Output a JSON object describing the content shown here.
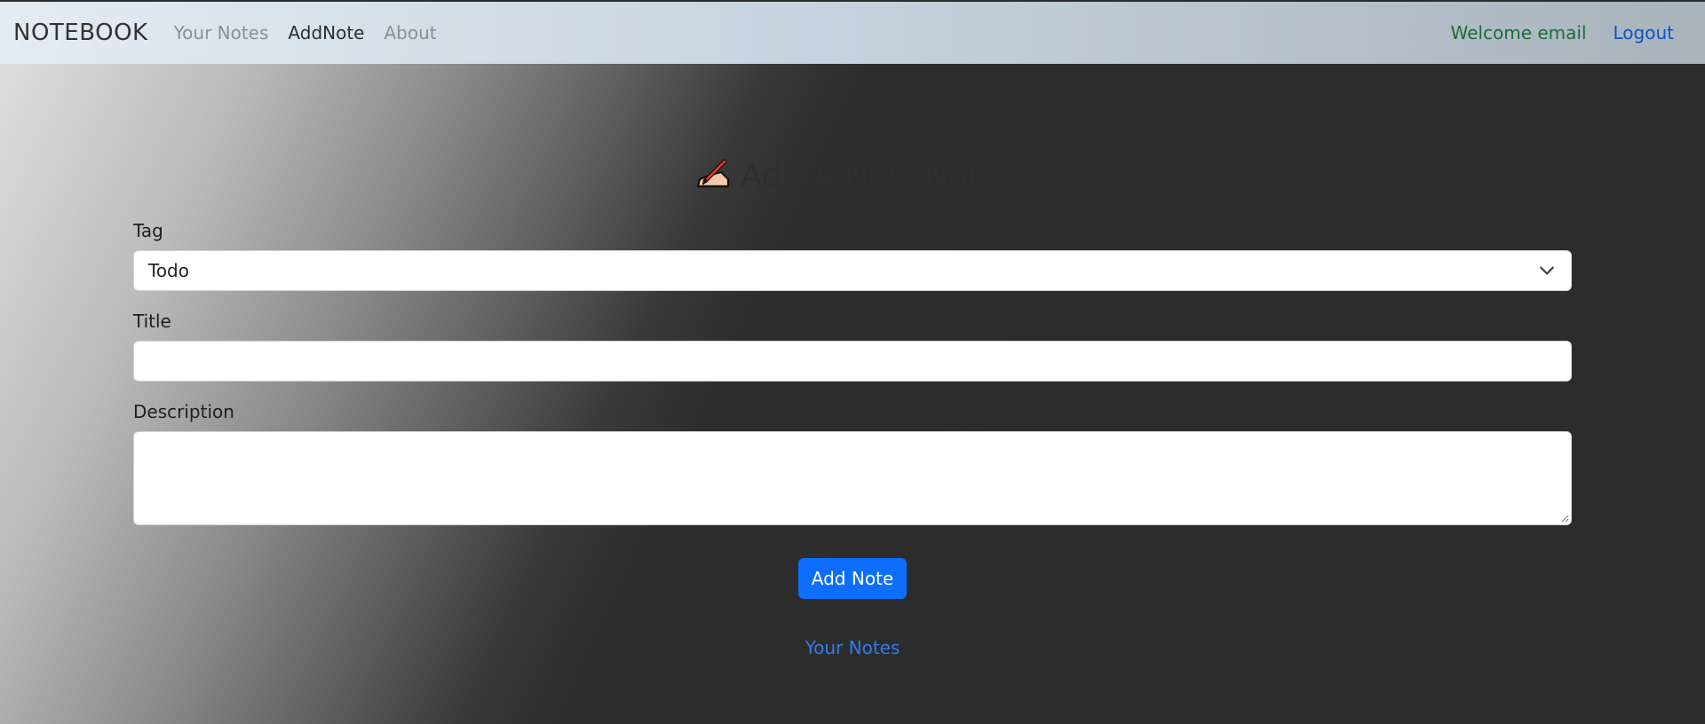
{
  "navbar": {
    "brand": "NOTEBOOK",
    "links": [
      {
        "label": "Your Notes",
        "active": false
      },
      {
        "label": "AddNote",
        "active": true
      },
      {
        "label": "About",
        "active": false
      }
    ],
    "welcome": "Welcome email",
    "logout": "Logout"
  },
  "page": {
    "heading": "Add A New Note:",
    "heading_icon": "writing-hand-icon"
  },
  "form": {
    "tag_label": "Tag",
    "tag_value": "Todo",
    "title_label": "Title",
    "title_value": "",
    "description_label": "Description",
    "description_value": "",
    "submit_label": "Add Note"
  },
  "footer": {
    "your_notes_link": "Your Notes"
  },
  "colors": {
    "primary": "#0d6efd",
    "welcome_text": "#1f6b3b",
    "logout_link": "#0d52c4"
  }
}
